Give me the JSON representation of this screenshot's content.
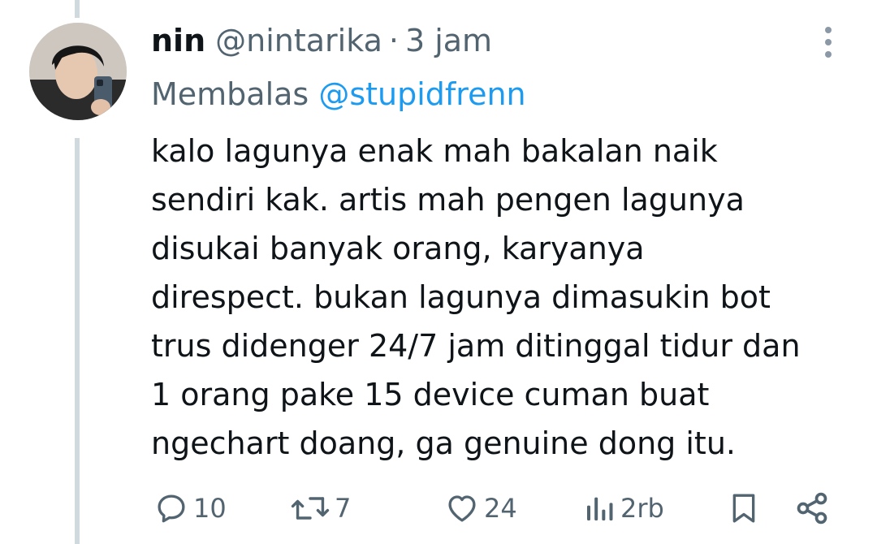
{
  "tweet": {
    "display_name": "nin",
    "handle": "@nintarika",
    "separator": "·",
    "timestamp": "3 jam",
    "reply_prefix": "Membalas",
    "reply_to": "@stupidfrenn",
    "text_lines": [
      "kalo lagunya enak mah bakalan naik",
      "sendiri kak. artis mah pengen lagunya",
      "disukai banyak orang, karyanya",
      "direspect. bukan lagunya dimasukin bot",
      "trus didenger 24/7 jam ditinggal tidur dan",
      "1 orang pake 15 device cuman buat",
      "ngechart doang, ga genuine dong itu."
    ]
  },
  "actions": {
    "reply": {
      "icon": "reply-icon",
      "count": "10"
    },
    "retweet": {
      "icon": "retweet-icon",
      "count": "7"
    },
    "like": {
      "icon": "heart-icon",
      "count": "24"
    },
    "views": {
      "icon": "views-icon",
      "count": "2rb"
    },
    "bookmark": {
      "icon": "bookmark-icon"
    },
    "share": {
      "icon": "share-icon"
    }
  },
  "colors": {
    "text": "#0f1419",
    "secondary": "#536471",
    "link": "#1d9bf0",
    "thread_line": "#cfd9de"
  }
}
